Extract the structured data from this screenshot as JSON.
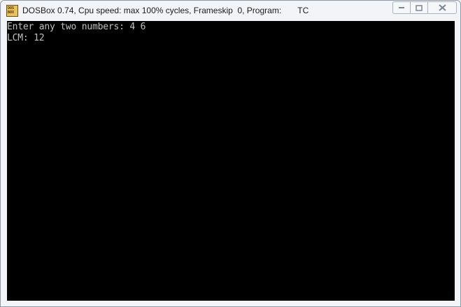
{
  "window": {
    "title": "DOSBox 0.74, Cpu speed: max 100% cycles, Frameskip  0, Program:       TC",
    "app_icon": "dosbox-icon",
    "app_icon_text": [
      "DOS",
      "BOX"
    ],
    "caption_buttons": [
      "minimize-icon",
      "maximize-icon",
      "close-icon"
    ]
  },
  "console": {
    "lines": [
      "Enter any two numbers: 4 6",
      "LCM: 12"
    ],
    "background": "#000000",
    "foreground": "#c0c0c0"
  }
}
